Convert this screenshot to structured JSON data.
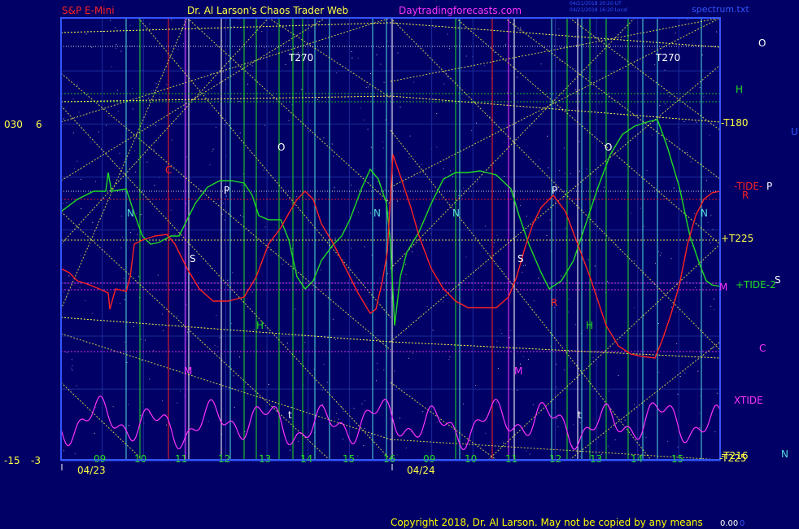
{
  "header": {
    "instrument": "S&P E-Mini",
    "site_name": "Dr. Al Larson's Chaos Trader Web",
    "url": "Daytradingforecasts.com",
    "timestamp_line1": "04/21/2018 20:20 UT",
    "timestamp_line2": "04/21/2018 16:20 Local",
    "filename": "spectrum.txt"
  },
  "footer": {
    "copyright": "Copyright 2018, Dr. Al Larson. May not be copied by any means",
    "value": "0.00",
    "value2": "0"
  },
  "colors": {
    "background": "#000066",
    "frame": "#3355ff",
    "price": "#ff2222",
    "green": "#22dd22",
    "magenta": "#ff33ff",
    "yellow": "#ffff44",
    "cyan": "#55dddd",
    "white": "#ffffff"
  },
  "chart_data": {
    "type": "line",
    "y_axis_labels": [
      {
        "left": "030",
        "right": "6",
        "level": "upper"
      },
      {
        "left": "-15",
        "right": "-3",
        "level": "lower"
      }
    ],
    "x_ticks": [
      "09",
      "10",
      "11",
      "12",
      "13",
      "14",
      "15",
      "16",
      "09",
      "10",
      "11",
      "12",
      "13",
      "14",
      "15"
    ],
    "dates": [
      "04/23",
      "04/24"
    ],
    "right_labels": [
      {
        "text": "O",
        "color": "white"
      },
      {
        "text": "H",
        "color": "green"
      },
      {
        "text": "-T180",
        "color": "yellow"
      },
      {
        "text": "U",
        "color": "blue"
      },
      {
        "text": "-TIDE-",
        "color": "red"
      },
      {
        "text": "P",
        "color": "white"
      },
      {
        "text": "R",
        "color": "red"
      },
      {
        "text": "+T225",
        "color": "yellow"
      },
      {
        "text": "M",
        "color": "magenta"
      },
      {
        "text": "+TIDE-2",
        "color": "green"
      },
      {
        "text": "S",
        "color": "white"
      },
      {
        "text": "C",
        "color": "magenta"
      },
      {
        "text": "XTIDE",
        "color": "magenta"
      },
      {
        "text": "-T216",
        "color": "yellow"
      },
      {
        "text": "-T225",
        "color": "yellow"
      },
      {
        "text": "N",
        "color": "cyan"
      }
    ],
    "in_chart_labels": [
      {
        "text": "T270",
        "color": "white"
      },
      {
        "text": "O",
        "color": "white"
      },
      {
        "text": "C",
        "color": "red"
      },
      {
        "text": "P",
        "color": "white"
      },
      {
        "text": "N",
        "color": "cyan"
      },
      {
        "text": "S",
        "color": "white"
      },
      {
        "text": "H",
        "color": "green"
      },
      {
        "text": "M",
        "color": "magenta"
      },
      {
        "text": "t",
        "color": "white"
      },
      {
        "text": "T270",
        "color": "white"
      },
      {
        "text": "O",
        "color": "white"
      },
      {
        "text": "P",
        "color": "white"
      },
      {
        "text": "N",
        "color": "cyan"
      },
      {
        "text": "N",
        "color": "cyan"
      },
      {
        "text": "S",
        "color": "white"
      },
      {
        "text": "R",
        "color": "red"
      },
      {
        "text": "H",
        "color": "green"
      },
      {
        "text": "M",
        "color": "magenta"
      },
      {
        "text": "t",
        "color": "white"
      },
      {
        "text": "N",
        "color": "cyan"
      }
    ]
  }
}
